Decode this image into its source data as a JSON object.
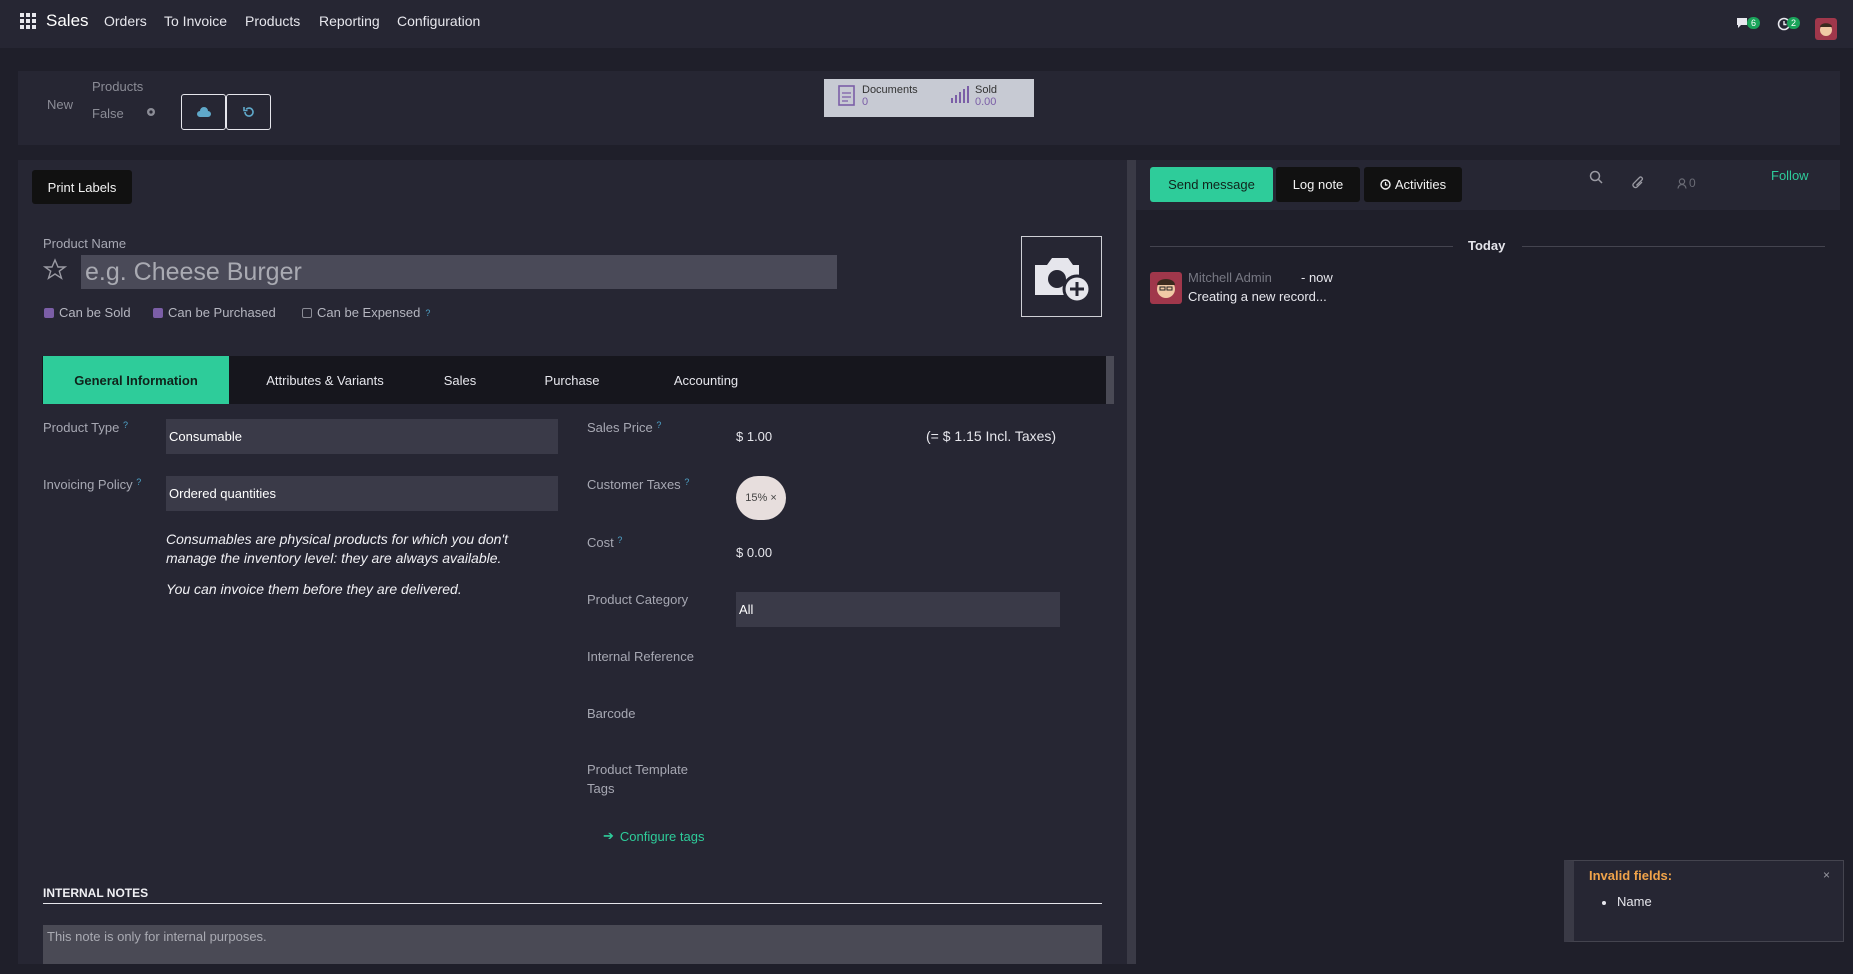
{
  "topbar": {
    "app_name": "Sales",
    "menu": [
      "Orders",
      "To Invoice",
      "Products",
      "Reporting",
      "Configuration"
    ],
    "messages_badge": "6",
    "activities_badge": "2"
  },
  "control_panel": {
    "breadcrumb_new": "New",
    "breadcrumb_parent": "Products",
    "record_state": "False",
    "documents_label": "Documents",
    "documents_value": "0",
    "sold_label": "Sold",
    "sold_value": "0.00"
  },
  "form": {
    "print_labels": "Print Labels",
    "product_name_label": "Product Name",
    "product_name_placeholder": "e.g. Cheese Burger",
    "checkboxes": [
      {
        "label": "Can be Sold",
        "checked": true
      },
      {
        "label": "Can be Purchased",
        "checked": true
      },
      {
        "label": "Can be Expensed",
        "checked": false
      }
    ],
    "tabs": [
      "General Information",
      "Attributes & Variants",
      "Sales",
      "Purchase",
      "Accounting"
    ],
    "active_tab": "General Information",
    "product_type_label": "Product Type",
    "product_type_value": "Consumable",
    "invoicing_policy_label": "Invoicing Policy",
    "invoicing_policy_value": "Ordered quantities",
    "help_text_1": "Consumables are physical products for which you don't manage the inventory level: they are always available.",
    "help_text_2": "You can invoice them before they are delivered.",
    "sales_price_label": "Sales Price",
    "sales_price_value": "$ 1.00",
    "sales_price_incl": "(= $ 1.15 Incl. Taxes)",
    "customer_taxes_label": "Customer Taxes",
    "customer_tax_tag": "15%",
    "cost_label": "Cost",
    "cost_value": "$ 0.00",
    "product_category_label": "Product Category",
    "product_category_value": "All",
    "internal_reference_label": "Internal Reference",
    "barcode_label": "Barcode",
    "product_template_tags_label_1": "Product Template",
    "product_template_tags_label_2": "Tags",
    "configure_tags": "Configure tags",
    "internal_notes_title": "INTERNAL NOTES",
    "internal_notes_placeholder": "This note is only for internal purposes."
  },
  "chatter": {
    "send_message": "Send message",
    "log_note": "Log note",
    "activities": "Activities",
    "followers_count": "0",
    "follow": "Follow",
    "date_separator": "Today",
    "author": "Mitchell Admin",
    "time": "- now",
    "body": "Creating a new record..."
  },
  "notification": {
    "title": "Invalid fields:",
    "item": "Name"
  },
  "colors": {
    "accent": "#2ecc9a",
    "background": "#1f1f2a",
    "panel": "#262633"
  }
}
